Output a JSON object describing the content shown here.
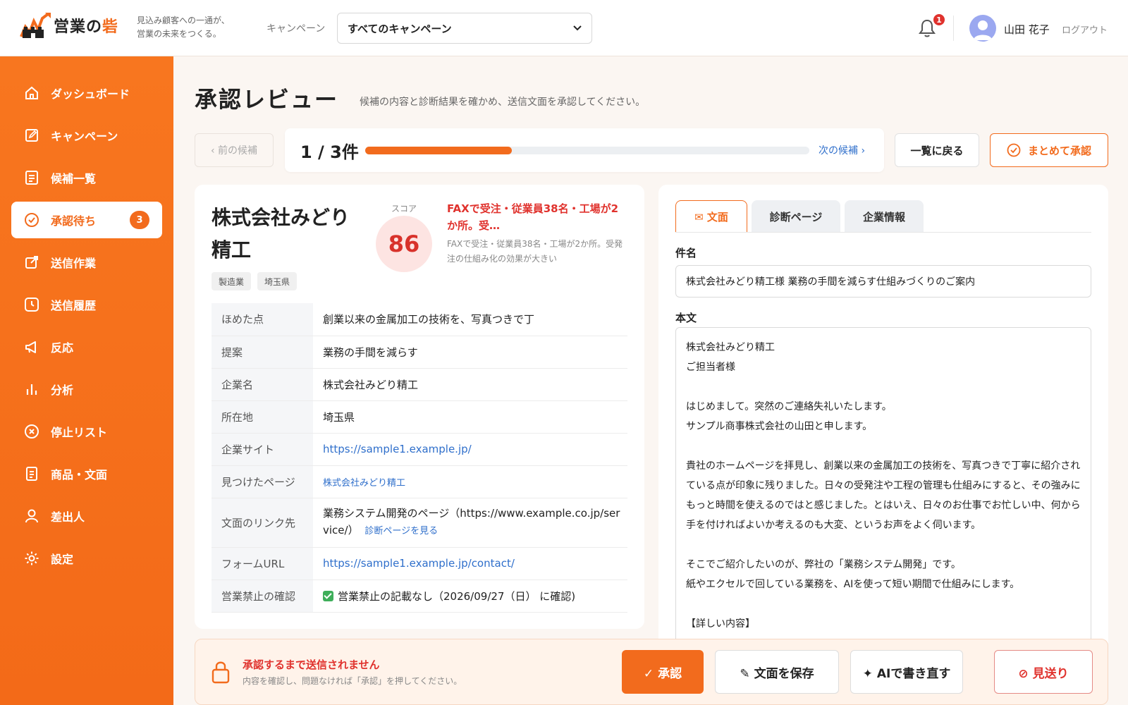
{
  "header": {
    "logo_text_a": "営業の",
    "logo_text_b": "砦",
    "tagline_1": "見込み顧客への一通が、",
    "tagline_2": "営業の未来をつくる。",
    "campaign_label": "キャンペーン",
    "campaign_selected": "すべてのキャンペーン",
    "notification_count": "1",
    "user_name": "山田 花子",
    "logout_label": "ログアウト"
  },
  "sidebar": {
    "items": [
      {
        "label": "ダッシュボード",
        "icon": "home-icon"
      },
      {
        "label": "キャンペーン",
        "icon": "edit-icon"
      },
      {
        "label": "候補一覧",
        "icon": "list-icon"
      },
      {
        "label": "承認待ち",
        "icon": "check-circle-icon",
        "badge": "3",
        "active": true
      },
      {
        "label": "送信作業",
        "icon": "send-icon"
      },
      {
        "label": "送信履歴",
        "icon": "clock-icon"
      },
      {
        "label": "反応",
        "icon": "megaphone-icon"
      },
      {
        "label": "分析",
        "icon": "bar-chart-icon"
      },
      {
        "label": "停止リスト",
        "icon": "x-circle-icon"
      },
      {
        "label": "商品・文面",
        "icon": "document-icon"
      },
      {
        "label": "差出人",
        "icon": "user-icon"
      },
      {
        "label": "設定",
        "icon": "gear-icon"
      }
    ]
  },
  "page": {
    "title": "承認レビュー",
    "subtitle": "候補の内容と診断結果を確かめ、送信文面を承認してください。"
  },
  "pager": {
    "prev_label": "‹ 前の候補",
    "count_label": "1 / 3件",
    "progress": 0.33,
    "next_label": "次の候補 ›",
    "back_label": "一覧に戻る",
    "bulk_label": "まとめて承認"
  },
  "candidate": {
    "company": "株式会社みどり精工",
    "tags": [
      "製造業",
      "埼玉県"
    ],
    "score_label": "スコア",
    "score": "86",
    "reason_title": "FAXで受注・従業員38名・工場が2か所。受…",
    "reason_sub": "FAXで受注・従業員38名・工場が2か所。受発注の仕組み化の効果が大きい",
    "rows": {
      "praise_k": "ほめた点",
      "praise_v": "創業以来の金属加工の技術を、写真つきで丁",
      "proposal_k": "提案",
      "proposal_v": "業務の手間を減らす",
      "company_k": "企業名",
      "company_v": "株式会社みどり精工",
      "location_k": "所在地",
      "location_v": "埼玉県",
      "site_k": "企業サイト",
      "site_v": "https://sample1.example.jp/",
      "found_k": "見つけたページ",
      "found_v": "株式会社みどり精工",
      "link_k": "文面のリンク先",
      "link_v": "業務システム開発のページ（https://www.example.co.jp/service/）",
      "link_diag": "診断ページを見る",
      "form_k": "フォームURL",
      "form_v": "https://sample1.example.jp/contact/",
      "ban_k": "営業禁止の確認",
      "ban_v": "営業禁止の記載なし（2026/09/27（日） に確認)"
    }
  },
  "editor": {
    "tabs": [
      {
        "label": "✉ 文面",
        "active": true
      },
      {
        "label": "診断ページ"
      },
      {
        "label": "企業情報"
      }
    ],
    "subject_label": "件名",
    "subject": "株式会社みどり精工様 業務の手間を減らす仕組みづくりのご案内",
    "body_label": "本文",
    "body": [
      "株式会社みどり精工",
      "ご担当者様",
      "",
      "はじめまして。突然のご連絡失礼いたします。",
      "サンプル商事株式会社の山田と申します。",
      "",
      "貴社のホームページを拝見し、創業以来の金属加工の技術を、写真つきで丁寧に紹介されている点が印象に残りました。日々の受発注や工程の管理も仕組みにすると、その強みにもっと時間を使えるのではと感じました。とはいえ、日々のお仕事でお忙しい中、何から手を付ければよいか考えるのも大変、というお声をよく伺います。",
      "",
      "そこでご紹介したいのが、弊社の「業務システム開発」です。",
      "紙やエクセルで回している業務を、AIを使って短い期間で仕組みにします。",
      "",
      "【詳しい内容】"
    ]
  },
  "bottom": {
    "warn_title": "承認するまで送信されません",
    "warn_sub": "内容を確認し、問題なければ「承認」を押してください。",
    "approve_label": "✓ 承認",
    "save_label": "✎ 文面を保存",
    "rewrite_label": "✦ AIで書き直す",
    "skip_label": "⊘ 見送り"
  },
  "colors": {
    "accent": "#f26b1d",
    "danger": "#e0322d",
    "link": "#2f6fcb"
  }
}
